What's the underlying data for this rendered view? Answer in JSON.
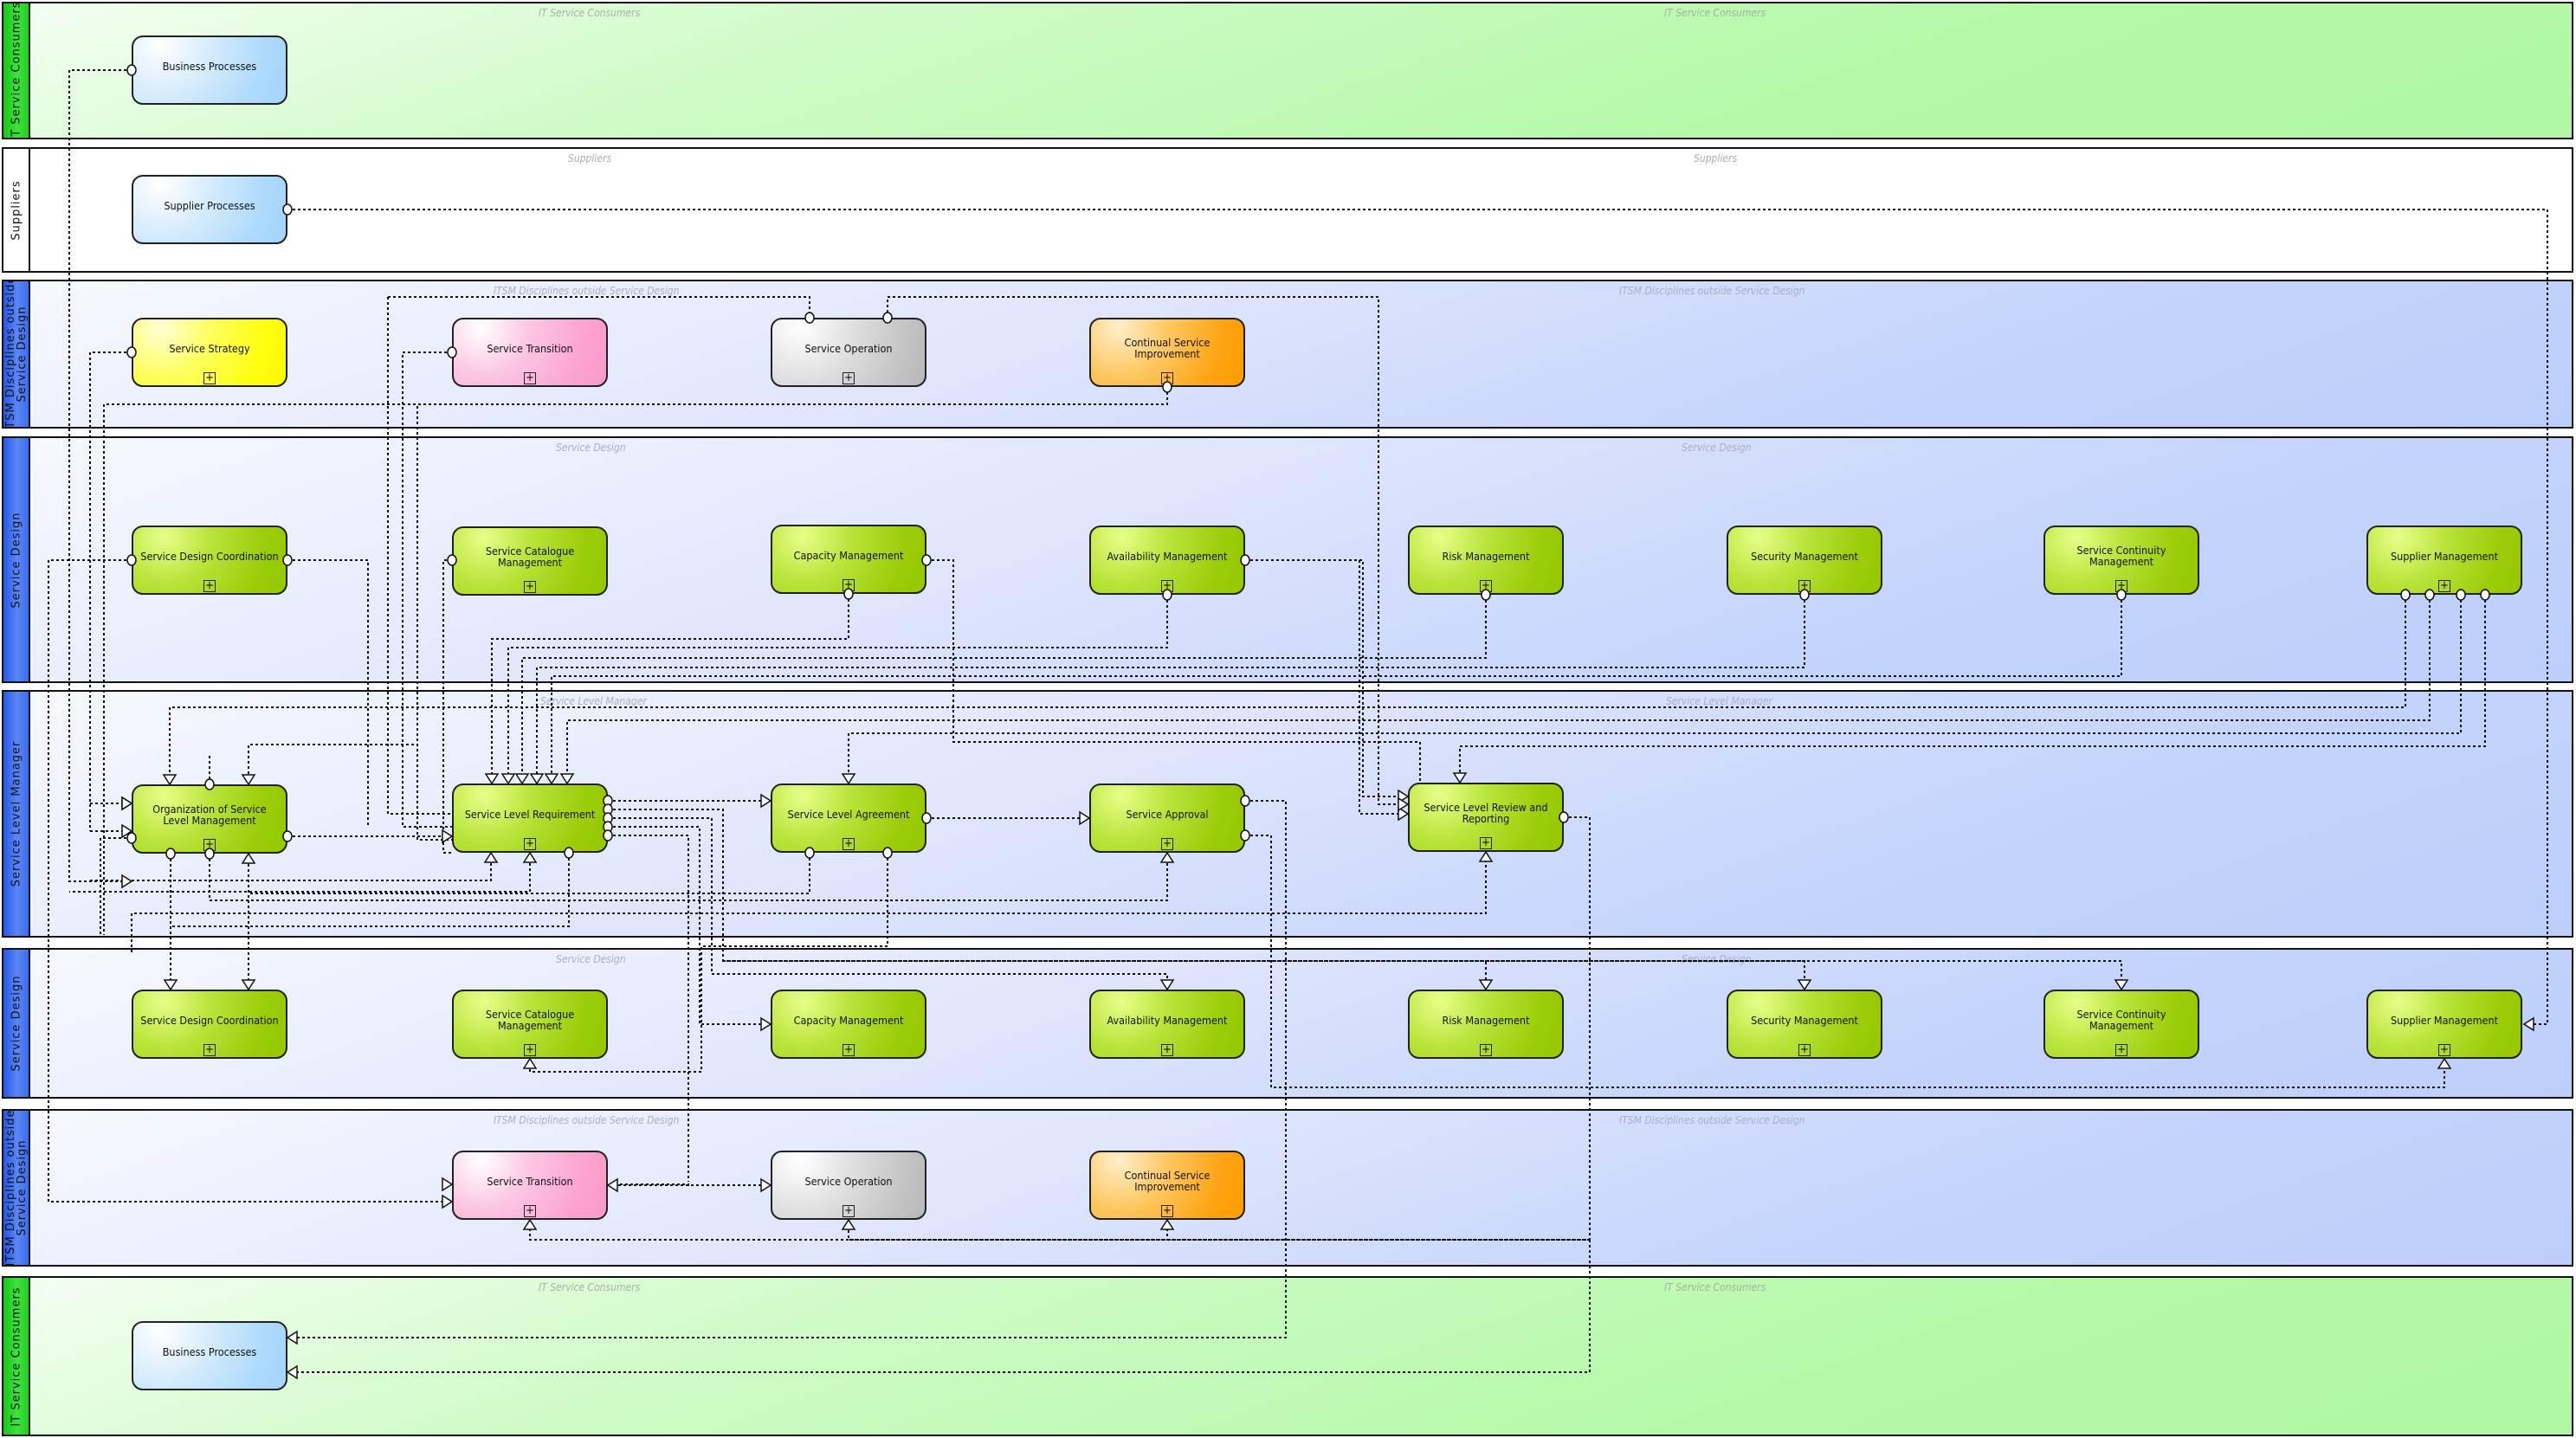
{
  "diagram": {
    "type": "swimlane-process-diagram",
    "lanes": [
      {
        "id": "L1",
        "title": "IT Service Consumers",
        "watermark": "IT Service Consumers",
        "style": "green"
      },
      {
        "id": "L2",
        "title": "Suppliers",
        "watermark": "Suppliers",
        "style": "white"
      },
      {
        "id": "L3",
        "title": "ITSM Disciplines outside\nService Design",
        "watermark": "ITSM Disciplines outside Service Design",
        "style": "blue"
      },
      {
        "id": "L4",
        "title": "Service Design",
        "watermark": "Service Design",
        "style": "blue"
      },
      {
        "id": "L5",
        "title": "Service Level Manager",
        "watermark": "Service Level Manager",
        "style": "blue"
      },
      {
        "id": "L6",
        "title": "Service Design",
        "watermark": "Service Design",
        "style": "blue"
      },
      {
        "id": "L7",
        "title": "ITSM Disciplines outside\nService Design",
        "watermark": "ITSM Disciplines outside Service Design",
        "style": "blue"
      },
      {
        "id": "L8",
        "title": "IT Service Consumers",
        "watermark": "IT Service Consumers",
        "style": "green"
      }
    ],
    "nodes": {
      "bp_top": {
        "label": "Business Processes",
        "style": "blue",
        "expandable": false
      },
      "sup": {
        "label": "Supplier Processes",
        "style": "blue",
        "expandable": false
      },
      "ss": {
        "label": "Service Strategy",
        "style": "yellow",
        "expandable": true
      },
      "st_top": {
        "label": "Service Transition",
        "style": "pink",
        "expandable": true
      },
      "so_top": {
        "label": "Service Operation",
        "style": "gray",
        "expandable": true
      },
      "csi_top": {
        "label": "Continual Service Improvement",
        "style": "orange",
        "expandable": true
      },
      "sdc_top": {
        "label": "Service Design Coordination",
        "style": "lime",
        "expandable": true
      },
      "scm_top": {
        "label": "Service Catalogue Management",
        "style": "lime",
        "expandable": true
      },
      "cap_top": {
        "label": "Capacity Management",
        "style": "lime",
        "expandable": true
      },
      "av_top": {
        "label": "Availability Management",
        "style": "lime",
        "expandable": true
      },
      "risk_top": {
        "label": "Risk Management",
        "style": "lime",
        "expandable": true
      },
      "sec_top": {
        "label": "Security Management",
        "style": "lime",
        "expandable": true
      },
      "cont_top": {
        "label": "Service Continuity Management",
        "style": "lime",
        "expandable": true
      },
      "supm_top": {
        "label": "Supplier Management",
        "style": "lime",
        "expandable": true
      },
      "oslm": {
        "label": "Organization of Service Level Management",
        "style": "lime",
        "expandable": true
      },
      "slr": {
        "label": "Service Level Requirement",
        "style": "lime",
        "expandable": true
      },
      "sla": {
        "label": "Service Level Agreement",
        "style": "lime",
        "expandable": true
      },
      "sap": {
        "label": "Service Approval",
        "style": "lime",
        "expandable": true
      },
      "slrr": {
        "label": "Service Level Review and Reporting",
        "style": "lime",
        "expandable": true
      },
      "sdc_bot": {
        "label": "Service Design Coordination",
        "style": "lime",
        "expandable": true
      },
      "scm_bot": {
        "label": "Service Catalogue Management",
        "style": "lime",
        "expandable": true
      },
      "cap_bot": {
        "label": "Capacity Management",
        "style": "lime",
        "expandable": true
      },
      "av_bot": {
        "label": "Availability Management",
        "style": "lime",
        "expandable": true
      },
      "risk_bot": {
        "label": "Risk Management",
        "style": "lime",
        "expandable": true
      },
      "sec_bot": {
        "label": "Security Management",
        "style": "lime",
        "expandable": true
      },
      "cont_bot": {
        "label": "Service Continuity Management",
        "style": "lime",
        "expandable": true
      },
      "supm_bot": {
        "label": "Supplier Management",
        "style": "lime",
        "expandable": true
      },
      "st_bot": {
        "label": "Service Transition",
        "style": "pink",
        "expandable": true
      },
      "so_bot": {
        "label": "Service Operation",
        "style": "gray",
        "expandable": true
      },
      "csi_bot": {
        "label": "Continual Service Improvement",
        "style": "orange",
        "expandable": true
      },
      "bp_bot": {
        "label": "Business Processes",
        "style": "blue",
        "expandable": false
      }
    },
    "edges": [
      {
        "from": "bp_top",
        "to": "oslm"
      },
      {
        "from": "sup",
        "to": "supm_bot"
      },
      {
        "from": "ss",
        "to": "oslm"
      },
      {
        "from": "st_top",
        "to": "slr"
      },
      {
        "from": "so_top",
        "to": "slr"
      },
      {
        "from": "so_top",
        "to": "slrr"
      },
      {
        "from": "csi_top",
        "to": "oslm"
      },
      {
        "from": "sdc_top",
        "to": "oslm"
      },
      {
        "from": "sdc_top",
        "to": "slr"
      },
      {
        "from": "scm_top",
        "to": "slr"
      },
      {
        "from": "cap_top",
        "to": "slr"
      },
      {
        "from": "cap_top",
        "to": "slrr"
      },
      {
        "from": "av_top",
        "to": "slr"
      },
      {
        "from": "av_top",
        "to": "slrr"
      },
      {
        "from": "risk_top",
        "to": "slr"
      },
      {
        "from": "sec_top",
        "to": "slr"
      },
      {
        "from": "cont_top",
        "to": "slr"
      },
      {
        "from": "supm_top",
        "to": "oslm"
      },
      {
        "from": "supm_top",
        "to": "sla"
      },
      {
        "from": "supm_top",
        "to": "sap"
      },
      {
        "from": "supm_top",
        "to": "slrr"
      },
      {
        "from": "oslm",
        "to": "slr"
      },
      {
        "from": "oslm",
        "to": "sdc_bot"
      },
      {
        "from": "oslm",
        "to": "sap"
      },
      {
        "from": "oslm",
        "to": "slrr"
      },
      {
        "from": "slr",
        "to": "sla"
      },
      {
        "from": "slr",
        "to": "cap_bot"
      },
      {
        "from": "slr",
        "to": "av_bot"
      },
      {
        "from": "slr",
        "to": "risk_bot"
      },
      {
        "from": "slr",
        "to": "sec_bot"
      },
      {
        "from": "slr",
        "to": "cont_bot"
      },
      {
        "from": "slr",
        "to": "st_bot"
      },
      {
        "from": "sla",
        "to": "sap"
      },
      {
        "from": "sla",
        "to": "oslm"
      },
      {
        "from": "sla",
        "to": "scm_bot"
      },
      {
        "from": "sap",
        "to": "bp_bot"
      },
      {
        "from": "sap",
        "to": "supm_bot"
      },
      {
        "from": "slrr",
        "to": "so_bot"
      },
      {
        "from": "slrr",
        "to": "csi_bot"
      },
      {
        "from": "slrr",
        "to": "st_bot"
      },
      {
        "from": "slrr",
        "to": "bp_bot"
      },
      {
        "from": "st_bot",
        "to": "so_bot"
      }
    ]
  }
}
